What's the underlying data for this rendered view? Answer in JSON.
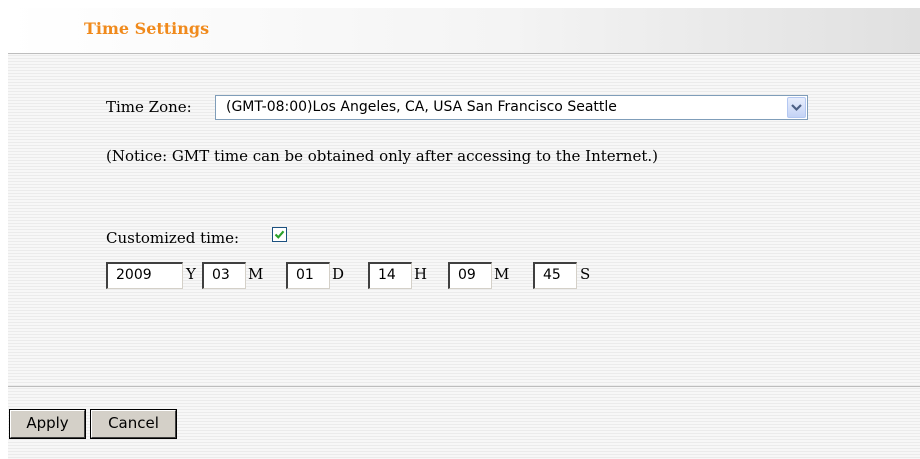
{
  "section": {
    "title": "Time Settings"
  },
  "timezone": {
    "label": "Time Zone:",
    "selected": "(GMT-08:00)Los Angeles, CA, USA San Francisco Seattle"
  },
  "notice": "(Notice: GMT time can be obtained only after accessing to the Internet.)",
  "custom_time": {
    "label": "Customized time:",
    "checked": true,
    "fields": [
      {
        "value": "2009",
        "unit": "Y"
      },
      {
        "value": "03",
        "unit": "M"
      },
      {
        "value": "01",
        "unit": "D"
      },
      {
        "value": "14",
        "unit": "H"
      },
      {
        "value": "09",
        "unit": "M"
      },
      {
        "value": "45",
        "unit": "S"
      }
    ]
  },
  "buttons": {
    "apply": "Apply",
    "cancel": "Cancel"
  },
  "colors": {
    "title": "#f08a1c",
    "check": "#2aa12a"
  }
}
